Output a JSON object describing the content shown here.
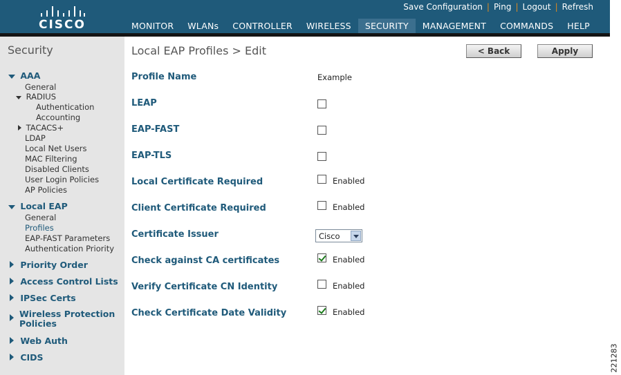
{
  "header": {
    "brand": "CISCO",
    "util_links": [
      "Save Configuration",
      "Ping",
      "Logout",
      "Refresh"
    ],
    "nav": [
      "MONITOR",
      "WLANs",
      "CONTROLLER",
      "WIRELESS",
      "SECURITY",
      "MANAGEMENT",
      "COMMANDS",
      "HELP"
    ],
    "active_nav": "SECURITY"
  },
  "sidebar": {
    "title": "Security",
    "aaa": {
      "label": "AAA",
      "items": [
        "General",
        "RADIUS",
        "Authentication",
        "Accounting",
        "TACACS+",
        "LDAP",
        "Local Net Users",
        "MAC Filtering",
        "Disabled Clients",
        "User Login Policies",
        "AP Policies"
      ]
    },
    "local_eap": {
      "label": "Local EAP",
      "items": [
        "General",
        "Profiles",
        "EAP-FAST Parameters",
        "Authentication Priority"
      ],
      "current": "Profiles"
    },
    "groups": [
      "Priority Order",
      "Access Control Lists",
      "IPSec Certs",
      "Wireless Protection Policies",
      "Web Auth",
      "CIDS"
    ]
  },
  "main": {
    "title": "Local EAP Profiles > Edit",
    "back_label": "< Back",
    "apply_label": "Apply",
    "profile_name_label": "Profile Name",
    "profile_name_value": "Example",
    "fields": [
      {
        "label": "LEAP",
        "checked": false,
        "suffix": ""
      },
      {
        "label": "EAP-FAST",
        "checked": false,
        "suffix": ""
      },
      {
        "label": "EAP-TLS",
        "checked": false,
        "suffix": ""
      },
      {
        "label": "Local Certificate Required",
        "checked": false,
        "suffix": "Enabled"
      },
      {
        "label": "Client Certificate Required",
        "checked": false,
        "suffix": "Enabled"
      },
      {
        "label": "Check against CA certificates",
        "checked": true,
        "suffix": "Enabled"
      },
      {
        "label": "Verify Certificate CN Identity",
        "checked": false,
        "suffix": "Enabled"
      },
      {
        "label": "Check Certificate Date Validity",
        "checked": true,
        "suffix": "Enabled"
      }
    ],
    "issuer_label": "Certificate Issuer",
    "issuer_value": "Cisco"
  },
  "figure_number": "221283",
  "colors": {
    "header_bg": "#1f5a7a",
    "label_blue": "#1f5a7a",
    "active_tab_underline": "#f0a030",
    "sidebar_bg": "#e5e5e5"
  }
}
